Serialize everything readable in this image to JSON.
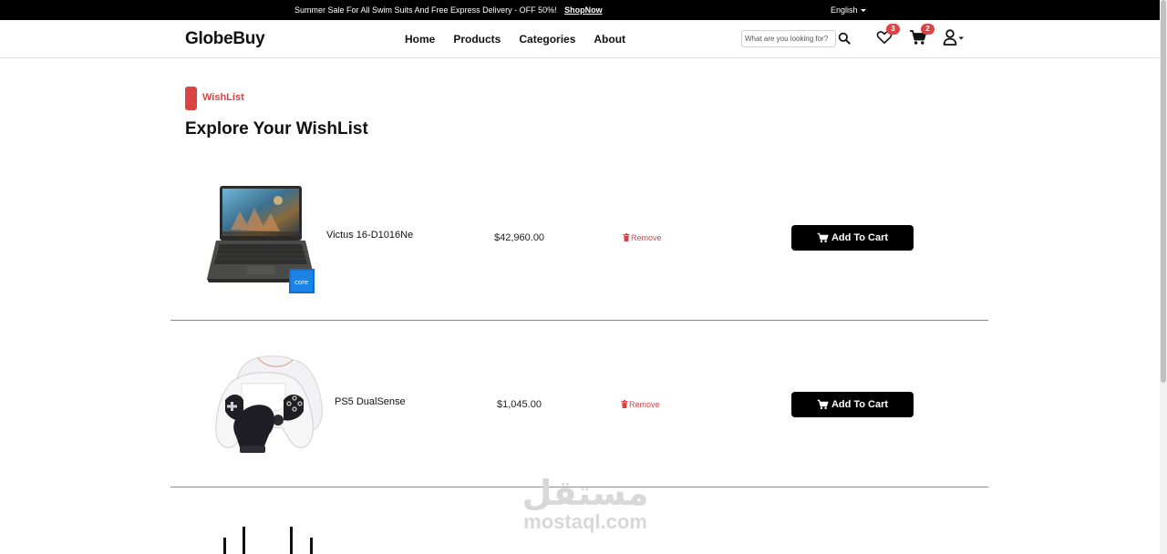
{
  "promo": {
    "message": "Summer Sale For All Swim Suits And Free Express Delivery - OFF 50%! ShopNow",
    "link": "ShopNow",
    "language": "English"
  },
  "nav": {
    "logo": "GlobeBuy",
    "links": [
      "Home",
      "Products",
      "Categories",
      "About"
    ],
    "search_placeholder": "What are you looking for?",
    "wishlist_count": "3",
    "cart_count": "2"
  },
  "section": {
    "tag": "WishList",
    "title": "Explore Your WishList"
  },
  "items": [
    {
      "name": "Victus 16-D1016Ne",
      "price": "$42,960.00",
      "remove": "Remove",
      "action": "Add To Cart"
    },
    {
      "name": "PS5 DualSense",
      "price": "$1,045.00",
      "remove": "Remove",
      "action": "Add To Cart"
    }
  ],
  "watermark": {
    "arabic": "مستقل",
    "latin": "mostaql.com"
  },
  "colors": {
    "accent": "#db4444",
    "dark": "#000000",
    "divider": "#8a8a8a"
  }
}
